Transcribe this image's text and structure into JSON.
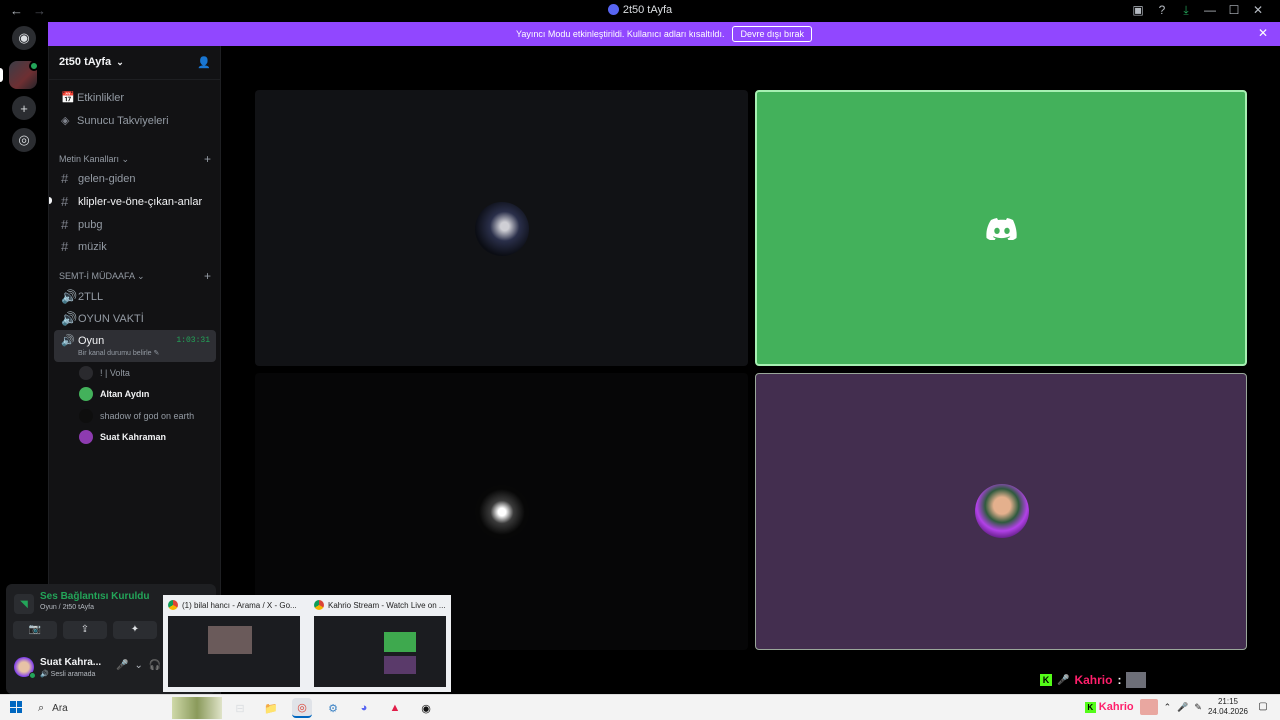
{
  "titlebar": {
    "title": "2t50 tAyfa",
    "back_glyph": "←",
    "forward_glyph": "→",
    "icons": [
      "screen-share-icon",
      "help-icon",
      "download-icon"
    ],
    "window_controls": [
      "—",
      "☐",
      "✕"
    ]
  },
  "guilds": {
    "home_glyph": "◉",
    "add_glyph": "+",
    "discover_glyph": "◎"
  },
  "banner": {
    "message": "Yayıncı Modu etkinleştirildi. Kullanıcı adları kısaltıldı.",
    "disable_label": "Devre dışı bırak",
    "close_glyph": "✕",
    "color": "#9147ff"
  },
  "server": {
    "name": "2t50 tAyfa",
    "chevron": "⌄",
    "invite_glyph": "👤"
  },
  "nav": [
    {
      "label": "Etkinlikler",
      "icon": "📅"
    },
    {
      "label": "Sunucu Takviyeleri",
      "icon": "◈"
    }
  ],
  "categories": {
    "text": {
      "label": "Metin Kanalları ⌄",
      "plus": "+"
    },
    "voice": {
      "label": "SEMT-İ MÜDAAFA ⌄",
      "plus": "+"
    }
  },
  "text_channels": [
    {
      "name": "gelen-giden",
      "glyph": "#"
    },
    {
      "name": "klipler-ve-öne-çıkan-anlar",
      "glyph": "#"
    },
    {
      "name": "pubg",
      "glyph": "#"
    },
    {
      "name": "müzik",
      "glyph": "#"
    }
  ],
  "voice_channels": [
    {
      "name": "2TLL",
      "glyph": "🔊"
    },
    {
      "name": "OYUN VAKTİ",
      "glyph": "🔊"
    }
  ],
  "active_voice": {
    "name": "Oyun",
    "glyph": "🔊",
    "elapsed": "1:03:31",
    "status": "Bir kanal durumu belirle ✎"
  },
  "members": [
    {
      "name": "! | Volta"
    },
    {
      "name": "Altan Aydın"
    },
    {
      "name": "shadow of god on earth"
    },
    {
      "name": "Suat Kahraman"
    }
  ],
  "voice_panel": {
    "title": "Ses Bağlantısı Kuruldu",
    "subtitle": "Oyun / 2t50 tAyfa",
    "buttons": [
      "📷",
      "⇪",
      "✦"
    ],
    "user_name": "Suat Kahra...",
    "user_state": "🔊 Sesli aramada",
    "controls": [
      "🎤",
      "⌄",
      "🎧"
    ]
  },
  "thumbnails": [
    {
      "title": "(1) bilal hancı - Arama / X - Go..."
    },
    {
      "title": "Kahrio Stream - Watch Live on ..."
    }
  ],
  "overlay": {
    "k": "K",
    "mic": "🎤",
    "name": "Kahrio",
    "colon": ":"
  },
  "taskbar": {
    "search_placeholder": "Ara",
    "search_glyph": "⌕",
    "apps": [
      "⊟",
      "📁",
      "◎",
      "⚙",
      "◕",
      "▲",
      "◉"
    ],
    "tray_name": "Kahrio",
    "tray_k": "K",
    "tray_glyphs": [
      "⌃",
      "🎤",
      "✎"
    ],
    "time": "21:15",
    "date": "24.04.2026",
    "notif_glyph": "▢"
  }
}
